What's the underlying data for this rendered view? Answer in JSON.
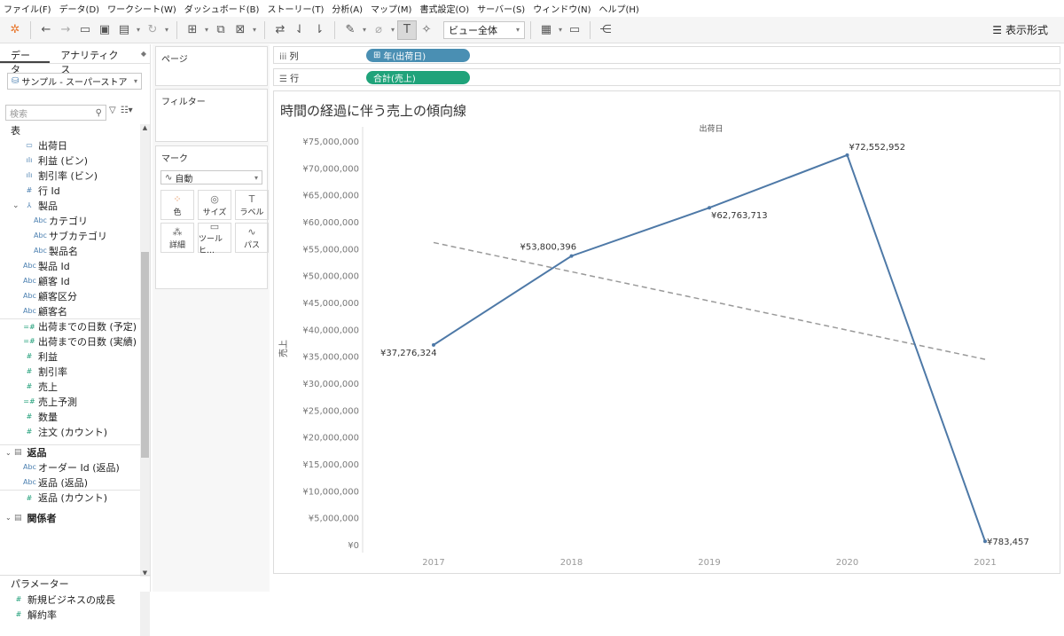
{
  "menu": [
    "ファイル(F)",
    "データ(D)",
    "ワークシート(W)",
    "ダッシュボード(B)",
    "ストーリー(T)",
    "分析(A)",
    "マップ(M)",
    "書式設定(O)",
    "サーバー(S)",
    "ウィンドウ(N)",
    "ヘルプ(H)"
  ],
  "toolbar": {
    "view_select": "ビュー全体",
    "show_me": "表示形式"
  },
  "tabs": {
    "data": "データ",
    "analytics": "アナリティクス"
  },
  "datasource": "サンプル - スーパーストア",
  "search_placeholder": "検索",
  "fields": {
    "table_header": "表",
    "items": [
      {
        "label": "出荷日",
        "icon": "date-icon"
      },
      {
        "label": "利益 (ビン)",
        "icon": "bin-icon"
      },
      {
        "label": "割引率 (ビン)",
        "icon": "bin-icon"
      },
      {
        "label": "行 Id",
        "icon": "number-icon"
      },
      {
        "label": "製品",
        "icon": "hierarchy-icon"
      },
      {
        "label": "カテゴリ",
        "icon": "abc-icon"
      },
      {
        "label": "サブカテゴリ",
        "icon": "abc-icon"
      },
      {
        "label": "製品名",
        "icon": "abc-icon"
      },
      {
        "label": "製品 Id",
        "icon": "abc-icon"
      },
      {
        "label": "顧客 Id",
        "icon": "abc-icon"
      },
      {
        "label": "顧客区分",
        "icon": "abc-icon"
      },
      {
        "label": "顧客名",
        "icon": "abc-icon"
      },
      {
        "label": "出荷までの日数 (予定)",
        "icon": "calc-measure-icon"
      },
      {
        "label": "出荷までの日数 (実績)",
        "icon": "calc-measure-icon"
      },
      {
        "label": "利益",
        "icon": "measure-icon"
      },
      {
        "label": "割引率",
        "icon": "measure-icon"
      },
      {
        "label": "売上",
        "icon": "measure-icon"
      },
      {
        "label": "売上予測",
        "icon": "calc-measure-icon"
      },
      {
        "label": "数量",
        "icon": "measure-icon"
      },
      {
        "label": "注文 (カウント)",
        "icon": "measure-icon"
      }
    ],
    "returns_header": "返品",
    "returns_items": [
      {
        "label": "オーダー Id (返品)",
        "icon": "abc-icon"
      },
      {
        "label": "返品 (返品)",
        "icon": "abc-icon"
      },
      {
        "label": "返品 (カウント)",
        "icon": "measure-icon"
      }
    ],
    "people_header": "関係者"
  },
  "parameters": {
    "header": "パラメーター",
    "items": [
      "新規ビジネスの成長",
      "解約率"
    ]
  },
  "cards": {
    "pages": "ページ",
    "filters": "フィルター",
    "marks": "マーク",
    "mark_type": "自動",
    "buttons": [
      "色",
      "サイズ",
      "ラベル",
      "詳細",
      "ツールヒ…",
      "パス"
    ]
  },
  "shelves": {
    "columns_label": "列",
    "columns_pill": "年(出荷日)",
    "rows_label": "行",
    "rows_pill": "合計(売上)",
    "columns_color": "#4a8fb3",
    "rows_color": "#1fa37a"
  },
  "chart_data": {
    "type": "line",
    "title": "時間の経過に伴う売上の傾向線",
    "xlabel": "出荷日",
    "ylabel": "売上",
    "categories": [
      "2017",
      "2018",
      "2019",
      "2020",
      "2021"
    ],
    "series": [
      {
        "values": [
          37276324,
          53800396,
          62763713,
          72552952,
          783457
        ]
      }
    ],
    "data_labels": [
      "¥37,276,324",
      "¥53,800,396",
      "¥62,763,713",
      "¥72,552,952",
      "¥783,457"
    ],
    "trend_line": {
      "start": [
        2017,
        56300000
      ],
      "end": [
        2021,
        34600000
      ],
      "style": "dashed"
    },
    "ylim": [
      0,
      75000000
    ],
    "ytick_labels": [
      "¥75,000,000",
      "¥70,000,000",
      "¥65,000,000",
      "¥60,000,000",
      "¥55,000,000",
      "¥50,000,000",
      "¥45,000,000",
      "¥40,000,000",
      "¥35,000,000",
      "¥30,000,000",
      "¥25,000,000",
      "¥20,000,000",
      "¥15,000,000",
      "¥10,000,000",
      "¥5,000,000",
      "¥0"
    ],
    "line_color": "#4e79a7",
    "trend_color": "#999999",
    "grid": false
  }
}
